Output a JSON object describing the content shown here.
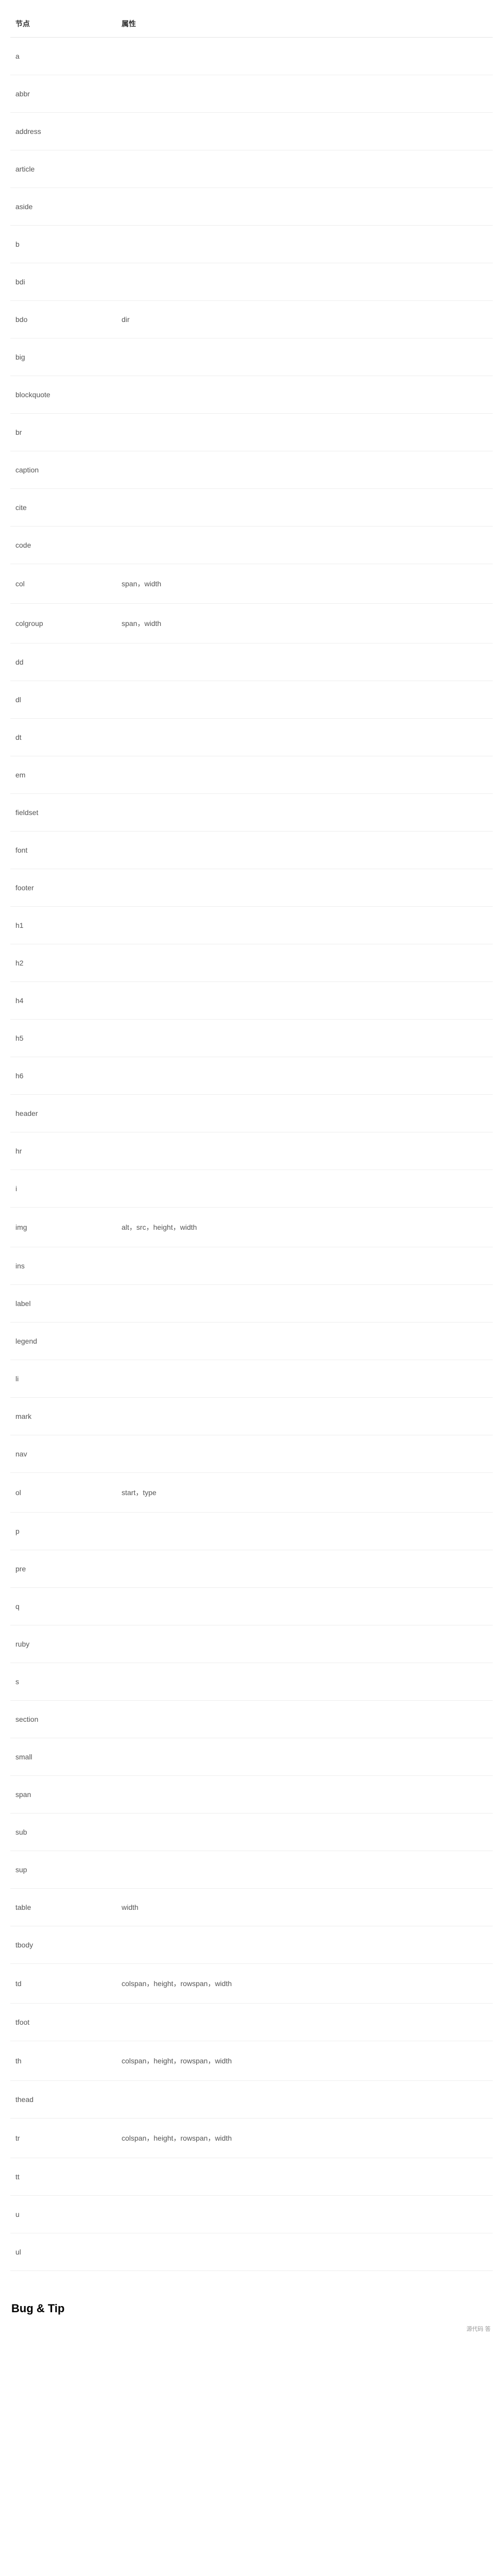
{
  "table": {
    "headers": {
      "node": "节点",
      "attr": "属性"
    },
    "rows": [
      {
        "node": "a",
        "attr": ""
      },
      {
        "node": "abbr",
        "attr": ""
      },
      {
        "node": "address",
        "attr": ""
      },
      {
        "node": "article",
        "attr": ""
      },
      {
        "node": "aside",
        "attr": ""
      },
      {
        "node": "b",
        "attr": ""
      },
      {
        "node": "bdi",
        "attr": ""
      },
      {
        "node": "bdo",
        "attr": "dir"
      },
      {
        "node": "big",
        "attr": ""
      },
      {
        "node": "blockquote",
        "attr": ""
      },
      {
        "node": "br",
        "attr": ""
      },
      {
        "node": "caption",
        "attr": ""
      },
      {
        "node": "cite",
        "attr": ""
      },
      {
        "node": "code",
        "attr": ""
      },
      {
        "node": "col",
        "attr": "span，width"
      },
      {
        "node": "colgroup",
        "attr": "span，width"
      },
      {
        "node": "dd",
        "attr": ""
      },
      {
        "node": "dl",
        "attr": ""
      },
      {
        "node": "dt",
        "attr": ""
      },
      {
        "node": "em",
        "attr": ""
      },
      {
        "node": "fieldset",
        "attr": ""
      },
      {
        "node": "font",
        "attr": ""
      },
      {
        "node": "footer",
        "attr": ""
      },
      {
        "node": "h1",
        "attr": ""
      },
      {
        "node": "h2",
        "attr": ""
      },
      {
        "node": "h4",
        "attr": ""
      },
      {
        "node": "h5",
        "attr": ""
      },
      {
        "node": "h6",
        "attr": ""
      },
      {
        "node": "header",
        "attr": ""
      },
      {
        "node": "hr",
        "attr": ""
      },
      {
        "node": "i",
        "attr": ""
      },
      {
        "node": "img",
        "attr": "alt，src，height，width"
      },
      {
        "node": "ins",
        "attr": ""
      },
      {
        "node": "label",
        "attr": ""
      },
      {
        "node": "legend",
        "attr": ""
      },
      {
        "node": "li",
        "attr": ""
      },
      {
        "node": "mark",
        "attr": ""
      },
      {
        "node": "nav",
        "attr": ""
      },
      {
        "node": "ol",
        "attr": "start，type"
      },
      {
        "node": "p",
        "attr": ""
      },
      {
        "node": "pre",
        "attr": ""
      },
      {
        "node": "q",
        "attr": ""
      },
      {
        "node": "ruby",
        "attr": ""
      },
      {
        "node": "s",
        "attr": ""
      },
      {
        "node": "section",
        "attr": ""
      },
      {
        "node": "small",
        "attr": ""
      },
      {
        "node": "span",
        "attr": ""
      },
      {
        "node": "sub",
        "attr": ""
      },
      {
        "node": "sup",
        "attr": ""
      },
      {
        "node": "table",
        "attr": "width"
      },
      {
        "node": "tbody",
        "attr": ""
      },
      {
        "node": "td",
        "attr": "colspan，height，rowspan，width"
      },
      {
        "node": "tfoot",
        "attr": ""
      },
      {
        "node": "th",
        "attr": "colspan，height，rowspan，width"
      },
      {
        "node": "thead",
        "attr": ""
      },
      {
        "node": "tr",
        "attr": "colspan，height，rowspan，width"
      },
      {
        "node": "tt",
        "attr": ""
      },
      {
        "node": "u",
        "attr": ""
      },
      {
        "node": "ul",
        "attr": ""
      }
    ]
  },
  "bottom_heading": "Bug & Tip",
  "footer_right": "源代码    答"
}
